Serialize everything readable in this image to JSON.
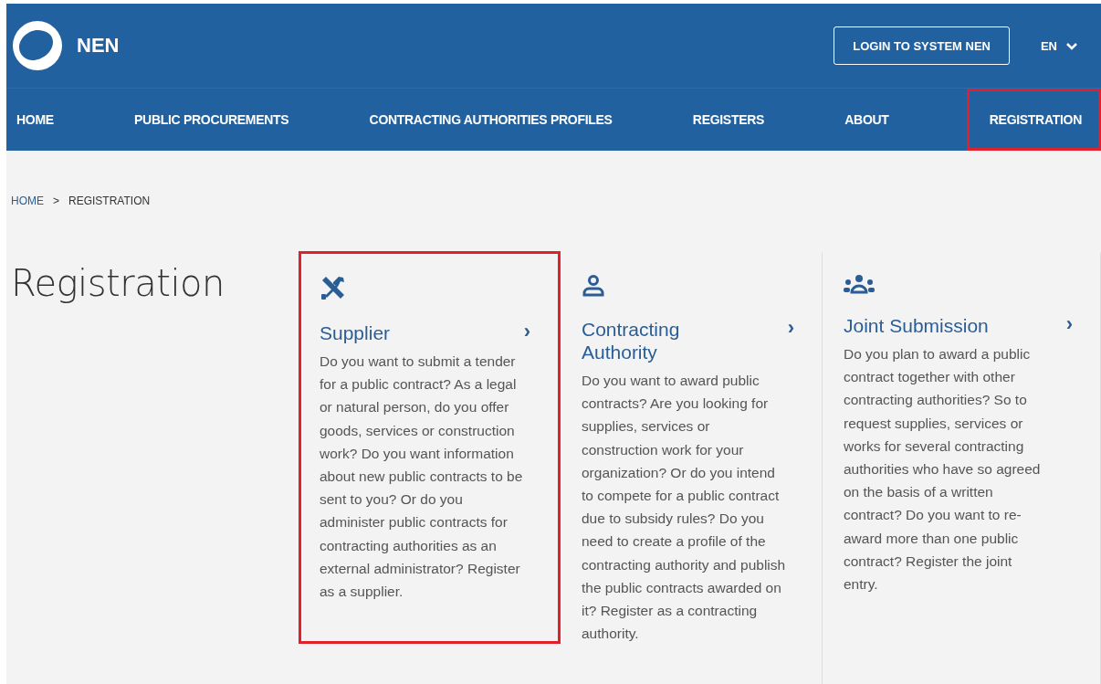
{
  "header": {
    "logo_text": "NEN",
    "login_button": "LOGIN TO SYSTEM NEN",
    "language": "EN"
  },
  "nav": [
    {
      "label": "HOME",
      "highlighted": false
    },
    {
      "label": "PUBLIC PROCUREMENTS",
      "highlighted": false
    },
    {
      "label": "CONTRACTING AUTHORITIES PROFILES",
      "highlighted": false
    },
    {
      "label": "REGISTERS",
      "highlighted": false
    },
    {
      "label": "ABOUT",
      "highlighted": false
    },
    {
      "label": "REGISTRATION",
      "highlighted": true
    }
  ],
  "breadcrumb": [
    {
      "label": "HOME",
      "kind": "link"
    },
    {
      "label": ">",
      "kind": "separator"
    },
    {
      "label": "REGISTRATION",
      "kind": "current"
    }
  ],
  "title": "Registration",
  "cards": [
    {
      "kind": "tools",
      "title": "Supplier",
      "chevron": "›",
      "highlighted": true,
      "text": "Do you want to submit a tender for a public contract? As a legal or natural person, do you offer goods, services or construction work? Do you want information about new public contracts to be sent to you? Or do you administer public contracts for contracting authorities as an external administrator? Register as a supplier."
    },
    {
      "kind": "person",
      "title": "Contracting Authority",
      "chevron": "›",
      "highlighted": false,
      "text": "Do you want to award public contracts? Are you looking for supplies, services or construction work for your organization? Or do you intend to compete for a public contract due to subsidy rules? Do you need to create a profile of the contracting authority and publish the public contracts awarded on it? Register as a contracting authority."
    },
    {
      "kind": "group",
      "title": "Joint Submission",
      "chevron": "›",
      "highlighted": false,
      "text": "Do you plan to award a public contract together with other contracting authorities? So to request supplies, services or works for several contracting authorities who have so agreed on the basis of a written contract? Do you want to re-award more than one public contract? Register the joint entry."
    }
  ]
}
